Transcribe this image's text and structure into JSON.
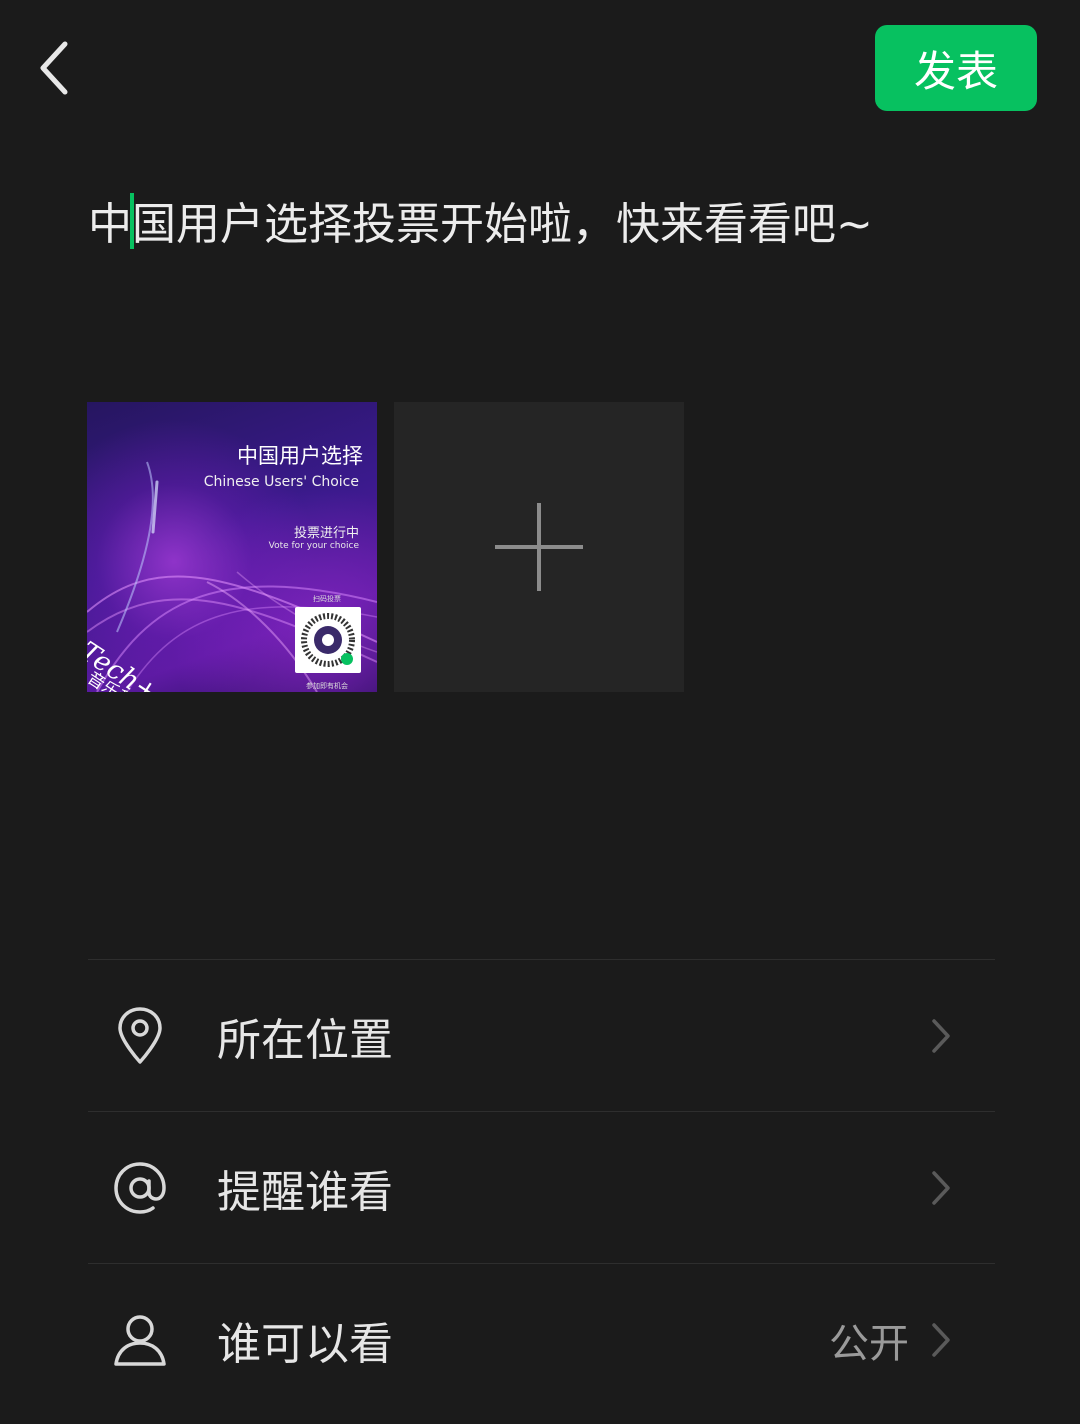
{
  "header": {
    "back_icon": "chevron-left-icon",
    "publish_label": "发表",
    "accent_color": "#07c160"
  },
  "post": {
    "text_before_caret": "中",
    "text_after_caret": "国用户选择投票开始啦，快来看看吧~"
  },
  "media": {
    "image": {
      "title": "中国用户选择",
      "subtitle": "Chinese Users' Choice",
      "vote_label": "投票进行中",
      "vote_label_en": "Vote for your choice",
      "scan_label": "扫码投票",
      "qr_caption": "参加即有机会",
      "brand": "Tech+ Music",
      "brand_cn": "音乐科技"
    },
    "add_icon": "plus-icon"
  },
  "options": [
    {
      "label": "所在位置",
      "icon": "location-pin-icon",
      "value": ""
    },
    {
      "label": "提醒谁看",
      "icon": "at-sign-icon",
      "value": ""
    },
    {
      "label": "谁可以看",
      "icon": "person-icon",
      "value": "公开"
    }
  ]
}
